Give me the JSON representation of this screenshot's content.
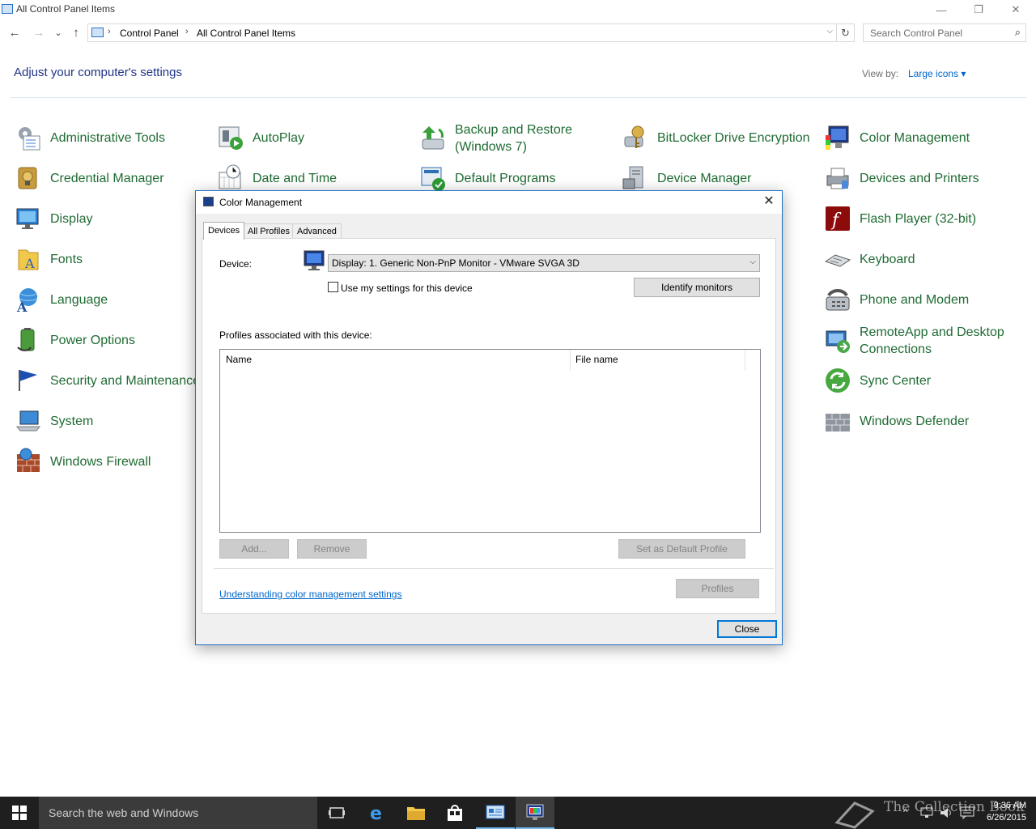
{
  "window": {
    "title": "All Control Panel Items",
    "minimize": "—",
    "restore": "❐",
    "close": "✕"
  },
  "nav": {
    "back": "←",
    "forward": "→",
    "recent": "⌄",
    "up": "↑",
    "breadcrumb": [
      "Control Panel",
      "All Control Panel Items"
    ],
    "separator": "›",
    "dropdown": "⌵",
    "refresh": "↻",
    "search_placeholder": "Search Control Panel",
    "search_icon": "⌕"
  },
  "header": {
    "heading": "Adjust your computer's settings",
    "view_by_label": "View by:",
    "view_by_value": "Large icons ▾"
  },
  "items": {
    "admin_tools": "Administrative Tools",
    "autoplay": "AutoPlay",
    "backup_l1": "Backup and Restore",
    "backup_l2": "(Windows 7)",
    "bitlocker": "BitLocker Drive Encryption",
    "color_mgmt": "Color Management",
    "credential": "Credential Manager",
    "date_time": "Date and Time",
    "default_programs": "Default Programs",
    "device_manager": "Device Manager",
    "devices_printers": "Devices and Printers",
    "display": "Display",
    "flash": "Flash Player (32-bit)",
    "fonts": "Fonts",
    "keyboard": "Keyboard",
    "language": "Language",
    "phone_modem": "Phone and Modem",
    "power": "Power Options",
    "remoteapp_l1": "RemoteApp and Desktop",
    "remoteapp_l2": "Connections",
    "security": "Security and Maintenance",
    "sync": "Sync Center",
    "system": "System",
    "defender": "Windows Defender",
    "firewall": "Windows Firewall"
  },
  "dialog": {
    "title": "Color Management",
    "close_x": "✕",
    "tabs": [
      "Devices",
      "All Profiles",
      "Advanced"
    ],
    "device_label": "Device:",
    "device_value": "Display: 1. Generic Non-PnP Monitor - VMware SVGA 3D",
    "select_arrow": "⌵",
    "use_settings_label": "Use my settings for this device",
    "use_settings_checked": false,
    "identify_button": "Identify monitors",
    "profiles_label": "Profiles associated with this device:",
    "columns": [
      "Name",
      "File name"
    ],
    "rows": [],
    "add_button": "Add...",
    "remove_button": "Remove",
    "set_default_button": "Set as Default Profile",
    "profiles_button": "Profiles",
    "help_link": "Understanding color management settings",
    "close_button": "Close"
  },
  "taskbar": {
    "search_placeholder": "Search the web and Windows",
    "tray_chevron": "^",
    "time": "9:36 AM",
    "date": "6/26/2015",
    "watermark": "The Collection Book"
  }
}
